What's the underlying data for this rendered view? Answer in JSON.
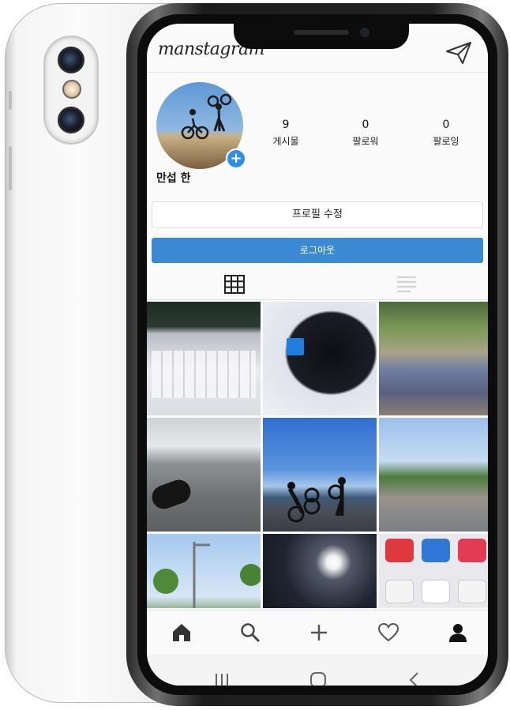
{
  "app": {
    "logo": "manstagram"
  },
  "profile": {
    "username": "만섭 한",
    "add_badge": "+",
    "stats": [
      {
        "value": "9",
        "label": "게시물"
      },
      {
        "value": "0",
        "label": "팔로워"
      },
      {
        "value": "0",
        "label": "팔로잉"
      }
    ]
  },
  "actions": {
    "edit_profile": "프로필 수정",
    "logout": "로그아웃"
  },
  "tabs": [
    {
      "icon": "grid-icon",
      "active": true
    },
    {
      "icon": "list-icon",
      "active": false
    }
  ],
  "posts": [
    {
      "image": "laptop-keyboard-photo"
    },
    {
      "image": "black-mouse-photo"
    },
    {
      "image": "flea-market-photo"
    },
    {
      "image": "laptop-and-mouse-photo"
    },
    {
      "image": "cyclists-seaside-photo"
    },
    {
      "image": "park-path-photo"
    },
    {
      "image": "park-lamp-photo"
    },
    {
      "image": "monitor-screen-photo"
    },
    {
      "image": "app-icons-photo"
    }
  ],
  "bottom_nav": [
    "home-icon",
    "search-icon",
    "add-icon",
    "heart-icon",
    "profile-icon"
  ],
  "system_nav": [
    "recent-apps-icon",
    "home-button-icon",
    "back-icon"
  ],
  "colors": {
    "accent": "#3a89d3",
    "badge": "#2f8fe6"
  }
}
